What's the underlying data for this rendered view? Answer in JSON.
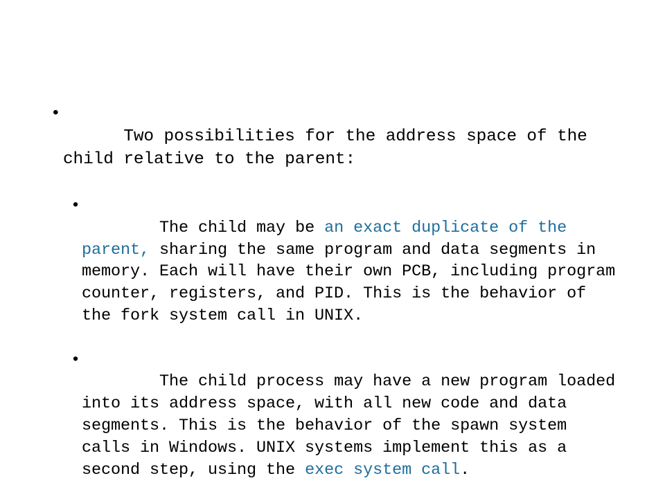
{
  "slide": {
    "background_color": "#ffffff",
    "text_color": "#000000",
    "highlight_color": "#1f6e9c",
    "bullet_glyph": "•"
  },
  "bullets": {
    "level1": {
      "bullet": "•",
      "text": "Two possibilities for the address space of the child relative to the parent:"
    },
    "level2": [
      {
        "bullet": "•",
        "segments": {
          "lead": "The child may be ",
          "highlight": "an exact duplicate of the parent,",
          "tail": " sharing the same program and data segments in memory. Each will have their own PCB, including program counter, registers, and PID. This is the behavior of the fork system call in UNIX."
        }
      },
      {
        "bullet": "•",
        "segments": {
          "lead": "The child process may have a new program loaded into its address space, with all new code and data segments. This is the behavior of the spawn system calls in Windows. UNIX systems implement this as a second step, using the ",
          "highlight": "exec system call",
          "tail": "."
        }
      }
    ]
  }
}
